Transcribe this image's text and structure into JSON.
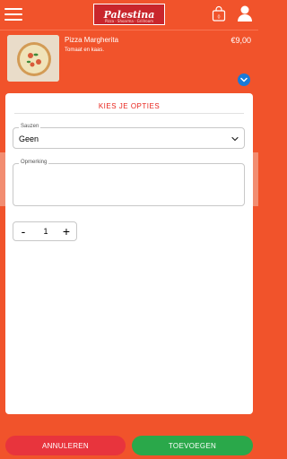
{
  "header": {
    "logo_text": "Palestina",
    "logo_subtitle": "Pizza · Shoarma · Grillroom",
    "cart_count": "0"
  },
  "item": {
    "name": "Pizza Margherita",
    "description": "Tomaat en kaas.",
    "price": "€9,00"
  },
  "options": {
    "title": "KIES JE OPTIES",
    "sauce_label": "Sauzen",
    "sauce_value": "Geen",
    "remark_label": "Opmerking",
    "remark_value": ""
  },
  "quantity": {
    "minus": "-",
    "value": "1",
    "plus": "+"
  },
  "actions": {
    "cancel_label": "ANNULEREN",
    "add_label": "TOEVOEGEN"
  },
  "colors": {
    "brand": "#f1532b",
    "accent_red": "#e8231b",
    "cancel": "#e8343d",
    "confirm": "#2aa84a",
    "info_blue": "#1a7ad8"
  }
}
